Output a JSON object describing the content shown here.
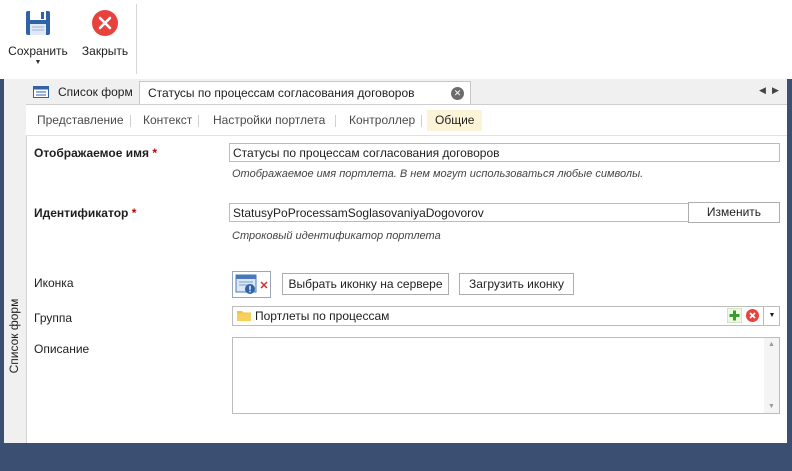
{
  "ribbon": {
    "save_label": "Сохранить",
    "close_label": "Закрыть"
  },
  "vertical_tab": {
    "label": "Список форм"
  },
  "doc_tabs": {
    "inactive_label": "Список форм",
    "active_label": "Статусы по процессам согласования договоров"
  },
  "sub_tabs": [
    "Представление",
    "Контекст",
    "Настройки портлета",
    "Контроллер",
    "Общие"
  ],
  "form": {
    "display_name": {
      "label": "Отображаемое имя",
      "required_mark": "*",
      "value": "Статусы по процессам согласования договоров",
      "hint": "Отображаемое имя портлета. В нем могут использоваться любые символы."
    },
    "identifier": {
      "label": "Идентификатор",
      "required_mark": "*",
      "value": "StatusyPoProcessamSoglasovaniyaDogovorov",
      "hint": "Строковый идентификатор портлета",
      "change_button": "Изменить"
    },
    "icon": {
      "label": "Иконка",
      "select_server_button": "Выбрать иконку на сервере",
      "upload_button": "Загрузить иконку"
    },
    "group": {
      "label": "Группа",
      "value": "Портлеты по процессам"
    },
    "description": {
      "label": "Описание",
      "value": ""
    }
  },
  "colors": {
    "accent_blue": "#3b4f73",
    "selected_tab": "#fdf3d6",
    "required": "#c00000",
    "close_red": "#e8423f"
  }
}
